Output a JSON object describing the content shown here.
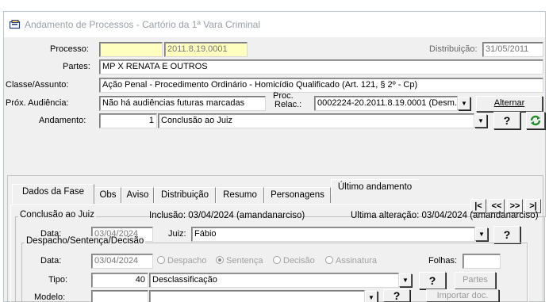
{
  "window": {
    "title": "Andamento de Processos - Cartório da 1ª Vara Criminal"
  },
  "form": {
    "processo": {
      "label": "Processo:",
      "value": "2011.8.19.0001"
    },
    "distribuicao": {
      "label": "Distribuição:",
      "value": "31/05/2011"
    },
    "partes": {
      "label": "Partes:",
      "value": "MP X RENATA E OUTROS"
    },
    "classe": {
      "label": "Classe/Assunto:",
      "value": "Ação Penal - Procedimento Ordinário - Homicídio Qualificado (Art. 121, § 2º - Cp)"
    },
    "audiencia": {
      "label": "Próx. Audiência:",
      "value": "Não há audiências futuras marcadas"
    },
    "proc_relac": {
      "label_line1": "Proc.",
      "label_line2": "Relac.:",
      "value": "0002224-20.2011.8.19.0001 (Desm.c"
    },
    "alternar_label": "Alternar",
    "andamento": {
      "label": "Andamento:",
      "number": "1",
      "value": "Conclusão ao Juiz"
    },
    "help_label": "?"
  },
  "tabs": [
    {
      "label": "Dados da Fase",
      "active": true
    },
    {
      "label": "Obs"
    },
    {
      "label": "Aviso"
    },
    {
      "label": "Distribuição"
    },
    {
      "label": "Resumo"
    },
    {
      "label": "Personagens"
    },
    {
      "label": "Último andamento"
    }
  ],
  "nav": {
    "first": "|<",
    "prev": "<<",
    "next": ">>",
    "last": ">|"
  },
  "fase": {
    "group_title": "Conclusão ao Juiz",
    "inclusao": "Inclusão: 03/04/2024 (amandanarciso)",
    "ultima_alteracao": "Última alteração: 03/04/2024 (amandanarciso)",
    "data_label": "Data:",
    "data_value": "03/04/2024",
    "juiz_label": "Juiz:",
    "juiz_value": "Fábio"
  },
  "despacho": {
    "group_title": "Despacho/Sentença/Decisão",
    "data_label": "Data:",
    "data_value": "03/04/2024",
    "options": [
      {
        "label": "Despacho",
        "checked": false
      },
      {
        "label": "Sentença",
        "checked": true
      },
      {
        "label": "Decisão",
        "checked": false
      },
      {
        "label": "Assinatura",
        "checked": false
      }
    ],
    "folhas_label": "Folhas:",
    "folhas_value": "",
    "tipo_label": "Tipo:",
    "tipo_number": "40",
    "tipo_value": "Desclassificação",
    "partes_button": "Partes",
    "modelo_label": "Modelo:",
    "modelo_value": "",
    "importar_button": "Importar doc."
  }
}
